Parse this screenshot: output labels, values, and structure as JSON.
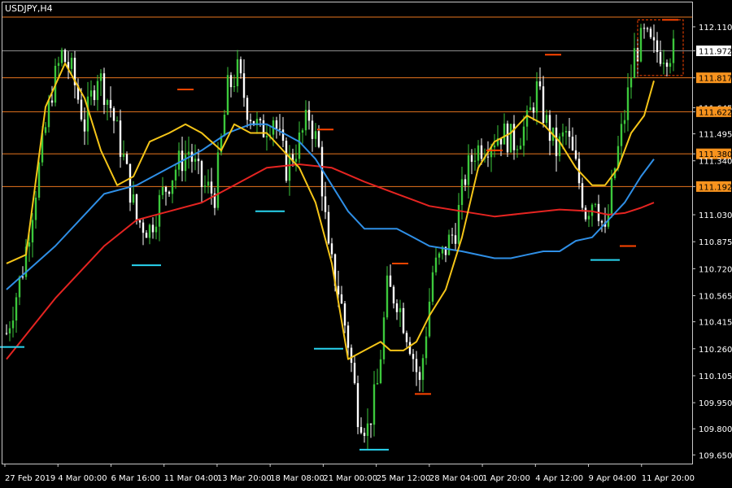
{
  "window": {
    "title": "USDJPY,H4"
  },
  "colors": {
    "background": "#000000",
    "frame": "#c8c8c8",
    "text": "#ffffff",
    "bull": "#3cc83c",
    "bear": "#ffffff",
    "sr_line": "#e8761e",
    "sr_tag_bg": "#f7931e",
    "sr_tag_text": "#000000",
    "ma_fast": "#f5c518",
    "ma_mid": "#2f8fe6",
    "ma_slow": "#e52421",
    "fractal_high": "#ff4500",
    "fractal_low": "#29d5f0",
    "bid_line": "#8c8c8c",
    "current_tag_bg": "#ffffff",
    "current_tag_text": "#000000"
  },
  "chart_data": {
    "type": "candlestick",
    "symbol": "USDJPY",
    "timeframe": "H4",
    "title": "USDJPY,H4",
    "ylim": [
      109.6,
      112.25
    ],
    "yticks": [
      "112.110",
      "111.972",
      "111.817",
      "111.645",
      "111.622",
      "111.495",
      "111.380",
      "111.340",
      "111.192",
      "111.030",
      "110.875",
      "110.720",
      "110.565",
      "110.415",
      "110.260",
      "110.105",
      "109.950",
      "109.800",
      "109.650"
    ],
    "xticks": [
      "27 Feb 2019",
      "4 Mar 00:00",
      "6 Mar 16:00",
      "11 Mar 04:00",
      "13 Mar 20:00",
      "18 Mar 08:00",
      "21 Mar 00:00",
      "25 Mar 12:00",
      "28 Mar 04:00",
      "1 Apr 20:00",
      "4 Apr 12:00",
      "9 Apr 04:00",
      "11 Apr 20:00"
    ],
    "support_resistance": [
      "112.166",
      "111.817",
      "111.622",
      "111.380",
      "111.192"
    ],
    "current_price": "111.972",
    "price_anchors": [
      [
        0,
        110.35
      ],
      [
        5,
        110.72
      ],
      [
        10,
        111.3
      ],
      [
        14,
        111.75
      ],
      [
        17,
        111.95
      ],
      [
        20,
        111.85
      ],
      [
        24,
        111.55
      ],
      [
        28,
        111.85
      ],
      [
        32,
        111.65
      ],
      [
        36,
        111.35
      ],
      [
        40,
        111.0
      ],
      [
        44,
        110.95
      ],
      [
        48,
        111.15
      ],
      [
        52,
        111.3
      ],
      [
        56,
        111.4
      ],
      [
        60,
        111.2
      ],
      [
        64,
        111.15
      ],
      [
        68,
        111.75
      ],
      [
        71,
        111.85
      ],
      [
        74,
        111.65
      ],
      [
        78,
        111.5
      ],
      [
        82,
        111.6
      ],
      [
        86,
        111.3
      ],
      [
        90,
        111.45
      ],
      [
        93,
        111.6
      ],
      [
        96,
        111.4
      ],
      [
        99,
        110.8
      ],
      [
        102,
        110.6
      ],
      [
        105,
        110.3
      ],
      [
        108,
        109.9
      ],
      [
        111,
        109.8
      ],
      [
        114,
        110.05
      ],
      [
        117,
        110.6
      ],
      [
        120,
        110.55
      ],
      [
        124,
        110.3
      ],
      [
        127,
        110.05
      ],
      [
        131,
        110.7
      ],
      [
        134,
        110.8
      ],
      [
        138,
        110.95
      ],
      [
        141,
        111.25
      ],
      [
        144,
        111.4
      ],
      [
        148,
        111.45
      ],
      [
        152,
        111.5
      ],
      [
        156,
        111.45
      ],
      [
        160,
        111.55
      ],
      [
        163,
        111.75
      ],
      [
        166,
        111.55
      ],
      [
        169,
        111.4
      ],
      [
        172,
        111.5
      ],
      [
        175,
        111.3
      ],
      [
        178,
        111.05
      ],
      [
        181,
        111.15
      ],
      [
        184,
        110.9
      ],
      [
        187,
        111.3
      ],
      [
        190,
        111.6
      ],
      [
        193,
        111.95
      ],
      [
        196,
        112.05
      ],
      [
        199,
        111.97
      ]
    ],
    "ma_fast": [
      [
        0,
        110.75
      ],
      [
        6,
        110.8
      ],
      [
        12,
        111.65
      ],
      [
        18,
        111.9
      ],
      [
        24,
        111.7
      ],
      [
        29,
        111.4
      ],
      [
        34,
        111.2
      ],
      [
        39,
        111.25
      ],
      [
        44,
        111.45
      ],
      [
        50,
        111.5
      ],
      [
        55,
        111.55
      ],
      [
        60,
        111.5
      ],
      [
        66,
        111.4
      ],
      [
        70,
        111.55
      ],
      [
        75,
        111.5
      ],
      [
        80,
        111.5
      ],
      [
        85,
        111.4
      ],
      [
        90,
        111.3
      ],
      [
        95,
        111.1
      ],
      [
        100,
        110.75
      ],
      [
        105,
        110.2
      ],
      [
        110,
        110.25
      ],
      [
        115,
        110.3
      ],
      [
        118,
        110.25
      ],
      [
        122,
        110.25
      ],
      [
        126,
        110.3
      ],
      [
        130,
        110.45
      ],
      [
        135,
        110.6
      ],
      [
        140,
        110.9
      ],
      [
        145,
        111.3
      ],
      [
        150,
        111.45
      ],
      [
        155,
        111.5
      ],
      [
        160,
        111.6
      ],
      [
        165,
        111.55
      ],
      [
        170,
        111.45
      ],
      [
        175,
        111.3
      ],
      [
        180,
        111.2
      ],
      [
        184,
        111.2
      ],
      [
        188,
        111.3
      ],
      [
        192,
        111.5
      ],
      [
        196,
        111.6
      ],
      [
        199,
        111.8
      ]
    ],
    "ma_mid": [
      [
        0,
        110.6
      ],
      [
        15,
        110.85
      ],
      [
        30,
        111.15
      ],
      [
        40,
        111.2
      ],
      [
        50,
        111.3
      ],
      [
        60,
        111.4
      ],
      [
        68,
        111.5
      ],
      [
        75,
        111.55
      ],
      [
        80,
        111.55
      ],
      [
        85,
        111.5
      ],
      [
        90,
        111.45
      ],
      [
        95,
        111.35
      ],
      [
        100,
        111.2
      ],
      [
        105,
        111.05
      ],
      [
        110,
        110.95
      ],
      [
        115,
        110.95
      ],
      [
        120,
        110.95
      ],
      [
        125,
        110.9
      ],
      [
        130,
        110.85
      ],
      [
        140,
        110.82
      ],
      [
        150,
        110.78
      ],
      [
        155,
        110.78
      ],
      [
        160,
        110.8
      ],
      [
        165,
        110.82
      ],
      [
        170,
        110.82
      ],
      [
        175,
        110.88
      ],
      [
        180,
        110.9
      ],
      [
        185,
        111.0
      ],
      [
        190,
        111.1
      ],
      [
        195,
        111.25
      ],
      [
        199,
        111.35
      ]
    ],
    "ma_slow": [
      [
        0,
        110.2
      ],
      [
        15,
        110.55
      ],
      [
        30,
        110.85
      ],
      [
        40,
        111.0
      ],
      [
        50,
        111.05
      ],
      [
        60,
        111.1
      ],
      [
        70,
        111.2
      ],
      [
        80,
        111.3
      ],
      [
        90,
        111.32
      ],
      [
        100,
        111.3
      ],
      [
        110,
        111.22
      ],
      [
        120,
        111.15
      ],
      [
        130,
        111.08
      ],
      [
        140,
        111.05
      ],
      [
        150,
        111.02
      ],
      [
        160,
        111.04
      ],
      [
        170,
        111.06
      ],
      [
        180,
        111.05
      ],
      [
        185,
        111.03
      ],
      [
        190,
        111.04
      ],
      [
        195,
        111.07
      ],
      [
        199,
        111.1
      ]
    ],
    "fractals_high": [
      [
        55,
        111.75
      ],
      [
        98,
        111.52
      ],
      [
        121,
        110.75
      ],
      [
        128,
        110.0
      ],
      [
        150,
        111.4
      ],
      [
        168,
        111.95
      ],
      [
        191,
        110.85
      ],
      [
        204,
        112.15
      ]
    ],
    "fractals_low": [
      [
        1,
        110.27
      ],
      [
        43,
        110.74
      ],
      [
        81,
        111.05
      ],
      [
        99,
        110.26
      ],
      [
        113,
        109.68
      ],
      [
        184,
        110.77
      ]
    ]
  }
}
